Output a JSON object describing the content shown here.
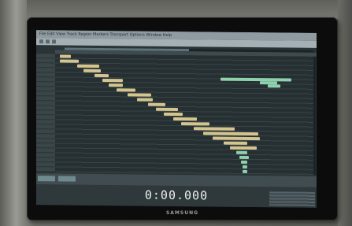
{
  "scene": {
    "monitor_brand": "SAMSUNG"
  },
  "app": {
    "menu_text": "File  Edit  View  Track  Region  Markers  Transport  Options  Window  Help",
    "timecode": "0:00.000",
    "playback_progress": 0.5
  },
  "colors": {
    "background": "#2a3437",
    "clip_beige": "#d4c590",
    "clip_green": "#8fd0ad",
    "timecode": "#eef2f2"
  }
}
